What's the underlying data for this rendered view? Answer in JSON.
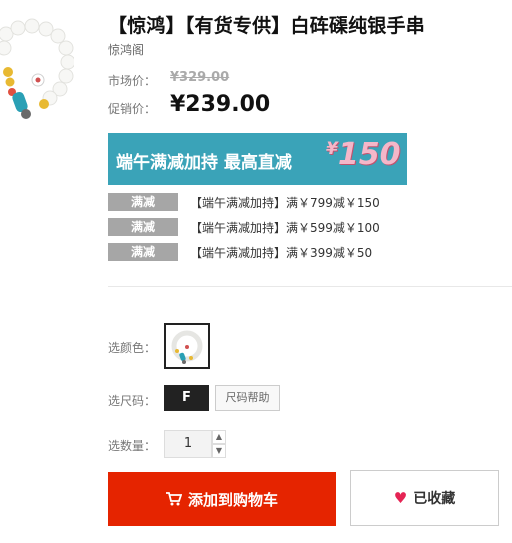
{
  "product": {
    "title": "【惊鸿】【有货专供】白砗磲纯银手串",
    "shop": "惊鸿阁"
  },
  "pricing": {
    "market_label": "市场价：",
    "market_value": "¥329.00",
    "sale_label": "促销价：",
    "sale_value": "¥239.00"
  },
  "banner": {
    "text": "端午满减加持  最高直减",
    "currency": "¥",
    "amount": "150",
    "bg_color": "#3aa3b8"
  },
  "promotions": [
    {
      "tag": "满减",
      "text": "【端午满减加持】满￥799减￥150"
    },
    {
      "tag": "满减",
      "text": "【端午满减加持】满￥599减￥100"
    },
    {
      "tag": "满减",
      "text": "【端午满减加持】满￥399减￥50"
    }
  ],
  "options": {
    "color_label": "选颜色：",
    "size_label": "选尺码：",
    "size_value": "F",
    "size_help": "尺码帮助",
    "quantity_label": "选数量：",
    "quantity_value": "1"
  },
  "actions": {
    "add_to_cart": "添加到购物车",
    "favorited": "已收藏",
    "cart_icon": "cart-icon",
    "heart_icon": "heart-icon",
    "accent_color": "#e52400"
  }
}
